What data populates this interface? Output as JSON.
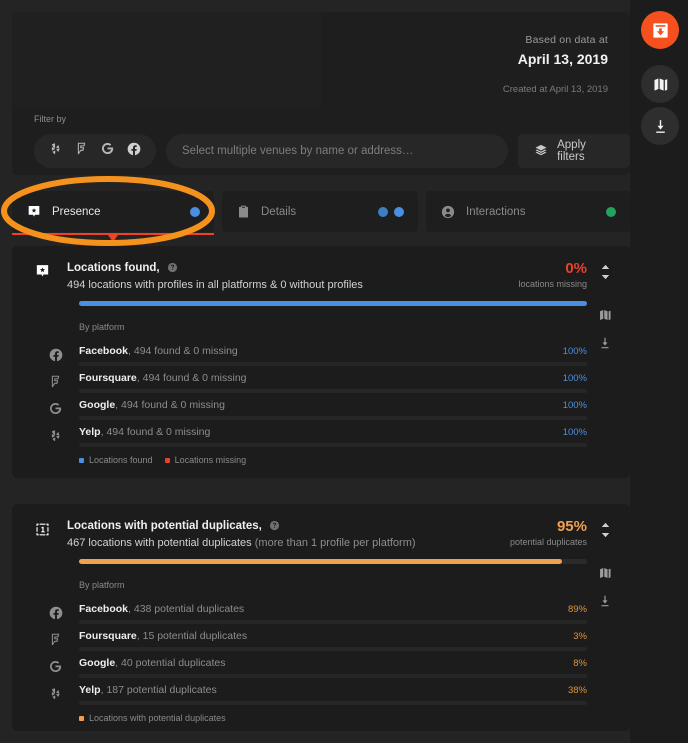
{
  "header": {
    "based_on_label": "Based on data at",
    "based_on_date": "April 13, 2019",
    "created_at": "Created at April 13, 2019",
    "filter_by_label": "Filter by",
    "venue_placeholder": "Select multiple venues by name or address…",
    "venue_value": "",
    "apply_filters_label": "Apply filters"
  },
  "platform_filters": [
    {
      "name": "yelp",
      "icon": "yelp-icon"
    },
    {
      "name": "foursquare",
      "icon": "foursquare-icon"
    },
    {
      "name": "google",
      "icon": "google-icon"
    },
    {
      "name": "facebook",
      "icon": "facebook-icon"
    }
  ],
  "tabs": [
    {
      "label": "Presence",
      "icon": "map-pin-badge-icon",
      "active": true,
      "dots": [
        "blue-b"
      ]
    },
    {
      "label": "Details",
      "icon": "clipboard-icon",
      "active": false,
      "dots": [
        "blue",
        "blue-b"
      ]
    },
    {
      "label": "Interactions",
      "icon": "user-circle-icon",
      "active": false,
      "dots": [
        "green"
      ]
    }
  ],
  "rail": [
    {
      "name": "inbox-download-icon",
      "active": true
    },
    {
      "name": "map-icon",
      "active": false
    },
    {
      "name": "download-icon",
      "active": false
    }
  ],
  "cards": [
    {
      "icon": "map-pin-badge-icon",
      "title": "Locations found,",
      "subtitle_main": "494 locations with profiles in all platforms & 0 without profiles",
      "subtitle_muted": "",
      "percent": "0%",
      "percent_label": "locations missing",
      "percent_color": "red",
      "bar_value": 100,
      "bar_color": "blue",
      "by_platform_label": "By platform",
      "tools": [
        "sort-chevrons-icon",
        "map-icon",
        "download-icon"
      ],
      "rows": [
        {
          "icon": "facebook-icon",
          "name": "Facebook",
          "desc": ", 494 found & 0 missing",
          "pct": "100%",
          "value": 100
        },
        {
          "icon": "foursquare-icon",
          "name": "Foursquare",
          "desc": ", 494 found & 0 missing",
          "pct": "100%",
          "value": 100
        },
        {
          "icon": "google-icon",
          "name": "Google",
          "desc": ", 494 found & 0 missing",
          "pct": "100%",
          "value": 100
        },
        {
          "icon": "yelp-icon",
          "name": "Yelp",
          "desc": ", 494 found & 0 missing",
          "pct": "100%",
          "value": 100
        }
      ],
      "legend": [
        {
          "label": "Locations found",
          "color": "#4a90e2"
        },
        {
          "label": "Locations missing",
          "color": "#e8412c"
        }
      ]
    },
    {
      "icon": "duplicate-icon",
      "title": "Locations with potential duplicates,",
      "subtitle_main": "467 locations with potential duplicates",
      "subtitle_muted": " (more than 1 profile per platform)",
      "percent": "95%",
      "percent_label": "potential duplicates",
      "percent_color": "orange",
      "bar_value": 95,
      "bar_color": "orange",
      "by_platform_label": "By platform",
      "tools": [
        "sort-chevrons-icon",
        "map-icon",
        "download-icon"
      ],
      "rows": [
        {
          "icon": "facebook-icon",
          "name": "Facebook",
          "desc": ", 438 potential duplicates",
          "pct": "89%",
          "value": 89
        },
        {
          "icon": "foursquare-icon",
          "name": "Foursquare",
          "desc": ", 15 potential duplicates",
          "pct": "3%",
          "value": 3
        },
        {
          "icon": "google-icon",
          "name": "Google",
          "desc": ", 40 potential duplicates",
          "pct": "8%",
          "value": 8
        },
        {
          "icon": "yelp-icon",
          "name": "Yelp",
          "desc": ", 187 potential duplicates",
          "pct": "38%",
          "value": 38
        }
      ],
      "legend": [
        {
          "label": "Locations with potential duplicates",
          "color": "#f0a050"
        }
      ]
    }
  ],
  "chart_data": [
    {
      "type": "bar",
      "title": "Locations found",
      "categories": [
        "Facebook",
        "Foursquare",
        "Google",
        "Yelp"
      ],
      "series": [
        {
          "name": "Locations found",
          "values": [
            100,
            100,
            100,
            100
          ]
        }
      ],
      "unit": "%",
      "overall": {
        "label": "locations missing",
        "value": 0
      },
      "counts": [
        494,
        494,
        494,
        494
      ],
      "missing": [
        0,
        0,
        0,
        0
      ],
      "legend": [
        "Locations found",
        "Locations missing"
      ],
      "ylim": [
        0,
        100
      ],
      "grid": false,
      "legend_position": "bottom-left"
    },
    {
      "type": "bar",
      "title": "Locations with potential duplicates",
      "categories": [
        "Facebook",
        "Foursquare",
        "Google",
        "Yelp"
      ],
      "series": [
        {
          "name": "Locations with potential duplicates",
          "values": [
            89,
            3,
            8,
            38
          ]
        }
      ],
      "unit": "%",
      "overall": {
        "label": "potential duplicates",
        "value": 95
      },
      "counts": [
        438,
        15,
        40,
        187
      ],
      "legend": [
        "Locations with potential duplicates"
      ],
      "ylim": [
        0,
        100
      ],
      "grid": false,
      "legend_position": "bottom-left"
    }
  ],
  "annotation": {
    "shape": "ellipse",
    "color": "#f5921e",
    "target": "Presence tab"
  },
  "colors": {
    "accent": "#f6501e",
    "blue": "#4a90e2",
    "blue_dark": "#2d5a8c",
    "orange": "#f0a050",
    "orange_dark": "#b0712c",
    "red": "#e8412c",
    "green": "#22a45d"
  }
}
